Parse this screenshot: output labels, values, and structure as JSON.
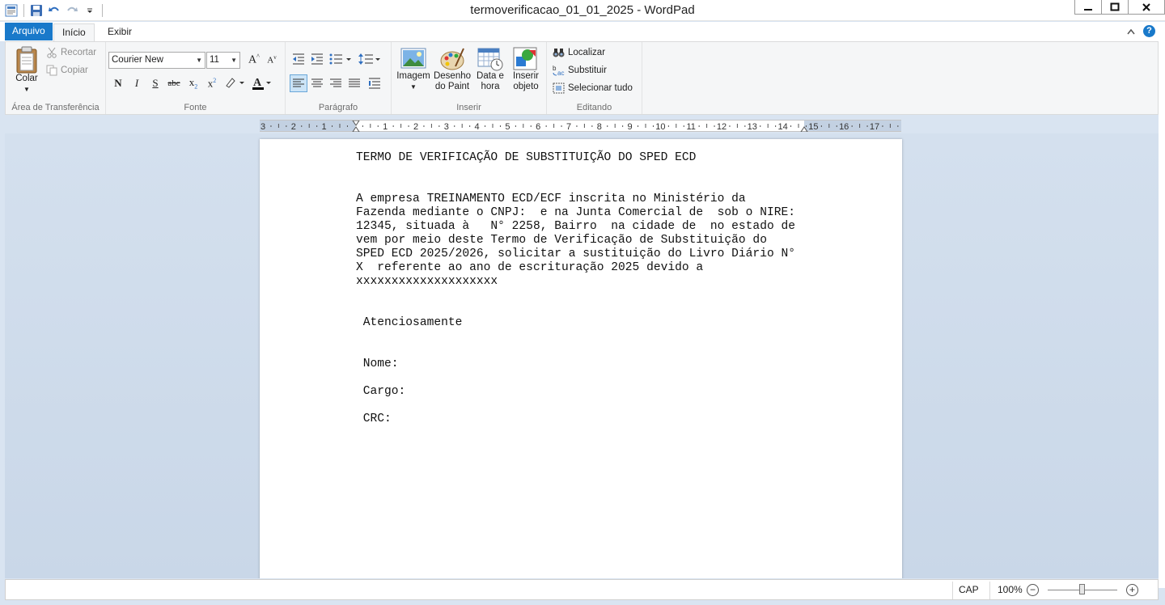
{
  "window": {
    "title": "termoverificacao_01_01_2025 - WordPad"
  },
  "tabs": {
    "file": "Arquivo",
    "home": "Início",
    "view": "Exibir"
  },
  "ribbon": {
    "clipboard": {
      "paste": "Colar",
      "cut": "Recortar",
      "copy": "Copiar",
      "label": "Área de Transferência"
    },
    "font": {
      "family": "Courier New",
      "size": "11",
      "bold": "N",
      "italic": "I",
      "underline": "S",
      "strike": "abc",
      "label": "Fonte"
    },
    "paragraph": {
      "label": "Parágrafo"
    },
    "insert": {
      "image": "Imagem",
      "paint_line1": "Desenho",
      "paint_line2": "do Paint",
      "date_line1": "Data e",
      "date_line2": "hora",
      "object_line1": "Inserir",
      "object_line2": "objeto",
      "label": "Inserir"
    },
    "editing": {
      "find": "Localizar",
      "replace": "Substituir",
      "select_all": "Selecionar tudo",
      "label": "Editando"
    }
  },
  "ruler": {
    "ticks": [
      "3",
      "2",
      "1",
      "1",
      "2",
      "3",
      "4",
      "5",
      "6",
      "7",
      "8",
      "9",
      "10",
      "11",
      "12",
      "13",
      "14",
      "15",
      "16",
      "17"
    ]
  },
  "document": {
    "lines": [
      "TERMO DE VERIFICAÇÃO DE SUBSTITUIÇÃO DO SPED ECD",
      "",
      "",
      "A empresa TREINAMENTO ECD/ECF inscrita no Ministério da",
      "Fazenda mediante o CNPJ:  e na Junta Comercial de  sob o NIRE:",
      "12345, situada à   N° 2258, Bairro  na cidade de  no estado de",
      "vem por meio deste Termo de Verificação de Substituição do",
      "SPED ECD 2025/2026, solicitar a sustituição do Livro Diário N°",
      "X  referente ao ano de escrituração 2025 devido a",
      "xxxxxxxxxxxxxxxxxxxx",
      "",
      "",
      " Atenciosamente",
      "",
      "",
      " Nome:",
      "",
      " Cargo:",
      "",
      " CRC:"
    ]
  },
  "status": {
    "caps": "CAP",
    "zoom": "100%",
    "zoom_level_percent": 100
  },
  "colors": {
    "accent": "#1979ca",
    "doc_background": "#d4e0ee"
  }
}
